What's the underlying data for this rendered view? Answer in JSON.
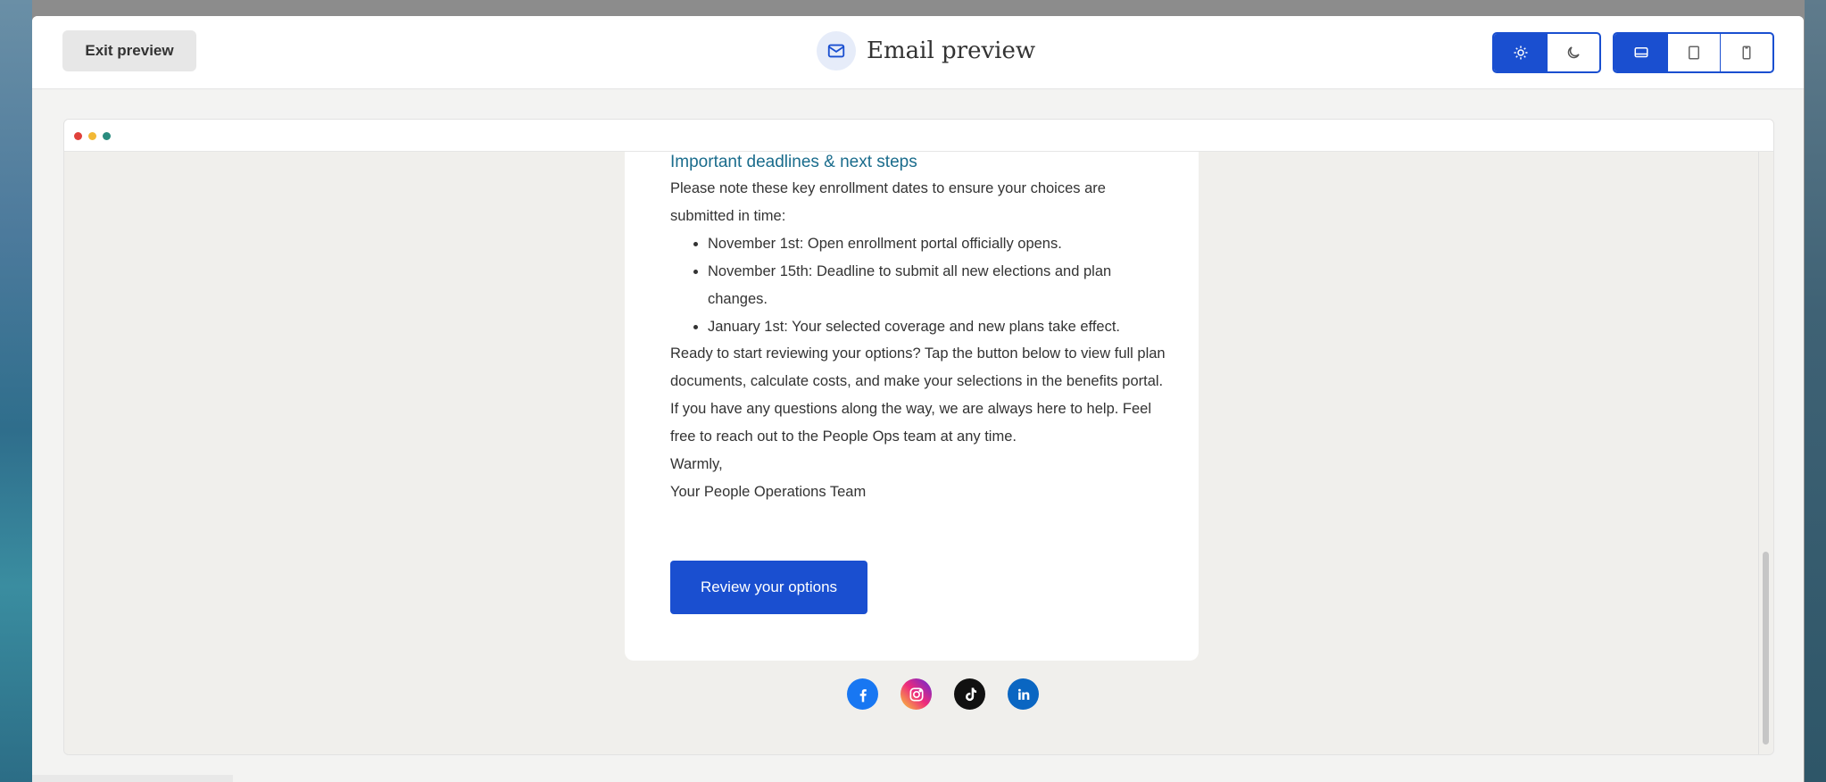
{
  "header": {
    "exit_label": "Exit preview",
    "title": "Email preview",
    "title_icon": "mail-icon",
    "theme_options": [
      {
        "name": "light",
        "icon": "sun-icon",
        "active": true
      },
      {
        "name": "dark",
        "icon": "moon-icon",
        "active": false
      }
    ],
    "device_options": [
      {
        "name": "desktop",
        "icon": "desktop-icon",
        "active": true
      },
      {
        "name": "tablet",
        "icon": "tablet-icon",
        "active": false
      },
      {
        "name": "mobile",
        "icon": "mobile-icon",
        "active": false
      }
    ],
    "accent_color": "#1a4fd0"
  },
  "preview": {
    "window_dots": [
      "#e0413b",
      "#f2b835",
      "#2a8c7f"
    ],
    "email": {
      "heading": "Important deadlines & next steps",
      "intro": "Please note these key enrollment dates to ensure your choices are submitted in time:",
      "deadlines": [
        {
          "date": "November 1st:",
          "text": " Open enrollment portal officially opens."
        },
        {
          "date": "November 15th:",
          "text": " Deadline to submit all new elections and plan changes."
        },
        {
          "date": "January 1st:",
          "text": " Your selected coverage and new plans take effect."
        }
      ],
      "review_text": "Ready to start reviewing your options? Tap the button below to view full plan documents, calculate costs, and make your selections in the benefits portal.",
      "questions_text": "If you have any questions along the way, we are always here to help. Feel free to reach out to the People Ops team at any time.",
      "signoff": "Warmly,",
      "signature": "Your People Operations Team",
      "cta_label": "Review your options"
    },
    "socials": [
      {
        "name": "facebook-icon",
        "color": "#1877f2"
      },
      {
        "name": "instagram-icon",
        "color": "#d62976"
      },
      {
        "name": "tiktok-icon",
        "color": "#111111"
      },
      {
        "name": "linkedin-icon",
        "color": "#0a66c2"
      }
    ]
  }
}
